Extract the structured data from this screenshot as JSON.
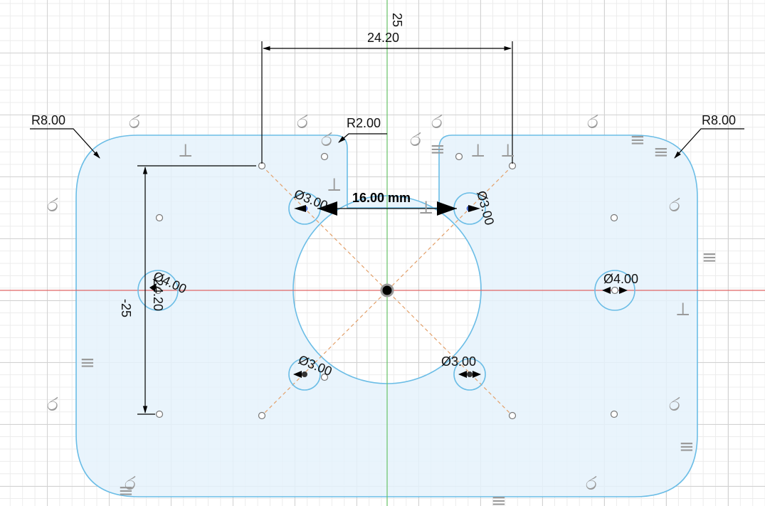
{
  "viewport": {
    "name": "sketch-canvas"
  },
  "colors": {
    "profile_fill": "#e5f2fb",
    "profile_stroke": "#6bbde6",
    "x_axis": "#e06666",
    "y_axis": "#66c266",
    "construction": "#e3a06a",
    "dimension": "#000000",
    "constraint_glyph": "#a0a0a0",
    "point": "#777777",
    "selected_point": "#4b6fd1"
  },
  "dimensions": {
    "width_top": "24.20",
    "vertical_offset_top": "25",
    "vertical_offset_side": "-25",
    "height_left": "24.20",
    "radius_top_left": "R8.00",
    "radius_top_right": "R8.00",
    "radius_slot": "R2.00",
    "slot_width": "16.00 mm",
    "hole_top_left": "Ø3.00",
    "hole_top_right": "Ø3.00",
    "hole_bottom_left": "Ø3.00",
    "hole_bottom_right": "Ø3.00",
    "hole_left": "Ø4.00",
    "hole_right": "Ø4.00"
  },
  "constraints": {
    "tangent_symbol": "ර",
    "perpendicular_symbol": "⟂",
    "parallel_symbol": "≡"
  }
}
